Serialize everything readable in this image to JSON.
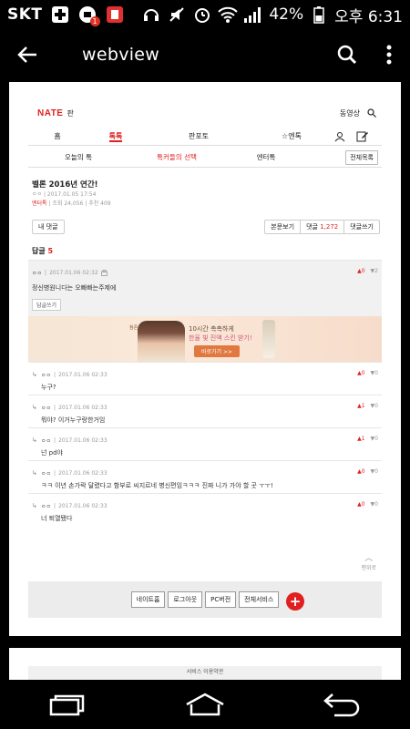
{
  "status_bar": {
    "carrier": "SKT",
    "battery": "42%",
    "time": "오후 6:31",
    "notification_badge": "1"
  },
  "app_bar": {
    "title": "webview"
  },
  "nate": {
    "logo": "NATE",
    "pan": "판",
    "video": "동영상",
    "main_tabs": [
      "홈",
      "톡톡",
      "판포토",
      "엔톡"
    ],
    "active_main_tab": "톡톡",
    "sub_tabs": [
      "오늘의 톡",
      "톡커들의 선택",
      "엔터톡"
    ],
    "active_sub_tab": "톡커들의 선택",
    "all_list": "전체목록"
  },
  "post": {
    "title": "벨론 2016년 연간!",
    "author": "ㅇㅇ",
    "date": "2017.01.05 17:54",
    "category": "엔터톡",
    "views": "조회 24,056",
    "recommend": "추천 409"
  },
  "buttons": {
    "my_comments": "내 댓글",
    "view_post": "본문보기",
    "comments_label": "댓글",
    "comments_count": "1,272",
    "write_comment": "댓글쓰기"
  },
  "replies": {
    "label": "답글",
    "count": "5"
  },
  "top_comment": {
    "author": "ㅇㅇ",
    "date": "2017.01.06 02:32",
    "body": "정신병원니다는 오빠빠는주제에",
    "up": "0",
    "down": "2",
    "reply_button": "답글쓰기"
  },
  "ad": {
    "brand": "참존",
    "line1": "10시간 촉촉하게",
    "line2": "한율 빛 진액 스킨 받기!",
    "cta": "바로가기 >>"
  },
  "sub_comments": [
    {
      "author": "ㅇㅇ",
      "date": "2017.01.06 02:33",
      "body": "누구?",
      "up": "0",
      "down": "0"
    },
    {
      "author": "ㅇㅇ",
      "date": "2017.01.06 02:33",
      "body": "뭐야? 이거누구랑한거임",
      "up": "1",
      "down": "0"
    },
    {
      "author": "ㅇㅇ",
      "date": "2017.01.06 02:33",
      "body": "넌 pd야",
      "up": "1",
      "down": "0"
    },
    {
      "author": "ㅇㅇ",
      "date": "2017.01.06 02:33",
      "body": "ㅋㅋ 이년 손가락 달렸다고 함부로 씨지르네 병신편임ㅋㅋㅋ 진짜 니가 가야 할 곳 ㅜㅜ!",
      "up": "0",
      "down": "0"
    },
    {
      "author": "ㅇㅇ",
      "date": "2017.01.06 02:33",
      "body": "너 퇴열됐다",
      "up": "0",
      "down": "0"
    }
  ],
  "to_top": "맨위로",
  "bottom_links": [
    "네이트홈",
    "로그아웃",
    "PC버전",
    "전체서비스"
  ],
  "footer": "서비스 이용약관"
}
